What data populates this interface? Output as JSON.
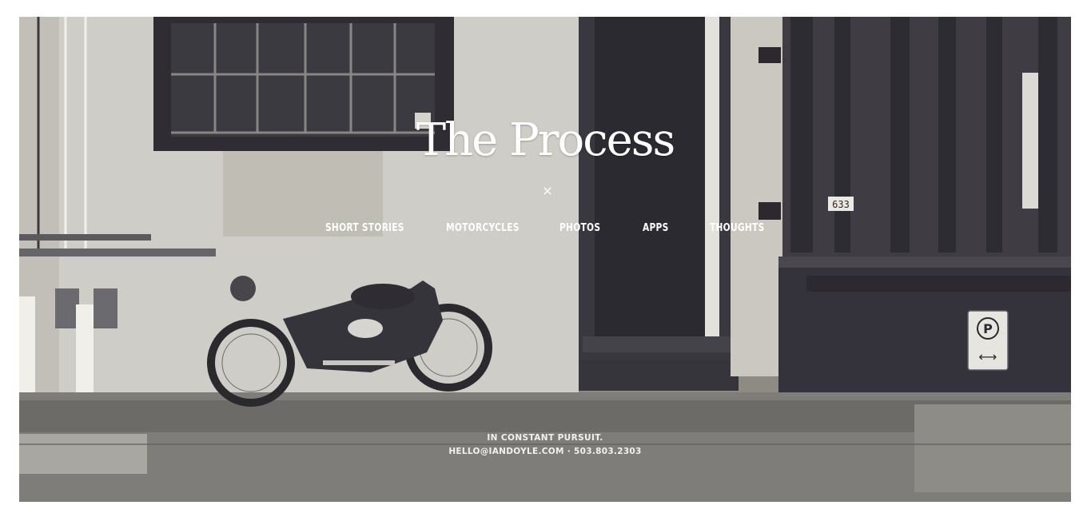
{
  "site": {
    "title": "The Process",
    "close_symbol": "×"
  },
  "nav": {
    "items": [
      {
        "label": "SHORT STORIES"
      },
      {
        "label": "MOTORCYCLES"
      },
      {
        "label": "PHOTOS"
      },
      {
        "label": "APPS"
      },
      {
        "label": "THOUGHTS"
      }
    ]
  },
  "footer": {
    "tagline": "IN CONSTANT PURSUIT.",
    "email": "HELLO@IANDOYLE.COM",
    "separator": "·",
    "phone": "503.803.2303"
  },
  "scene": {
    "building_number": "633",
    "parking_sign": "P",
    "parking_arrow": "⟷"
  }
}
